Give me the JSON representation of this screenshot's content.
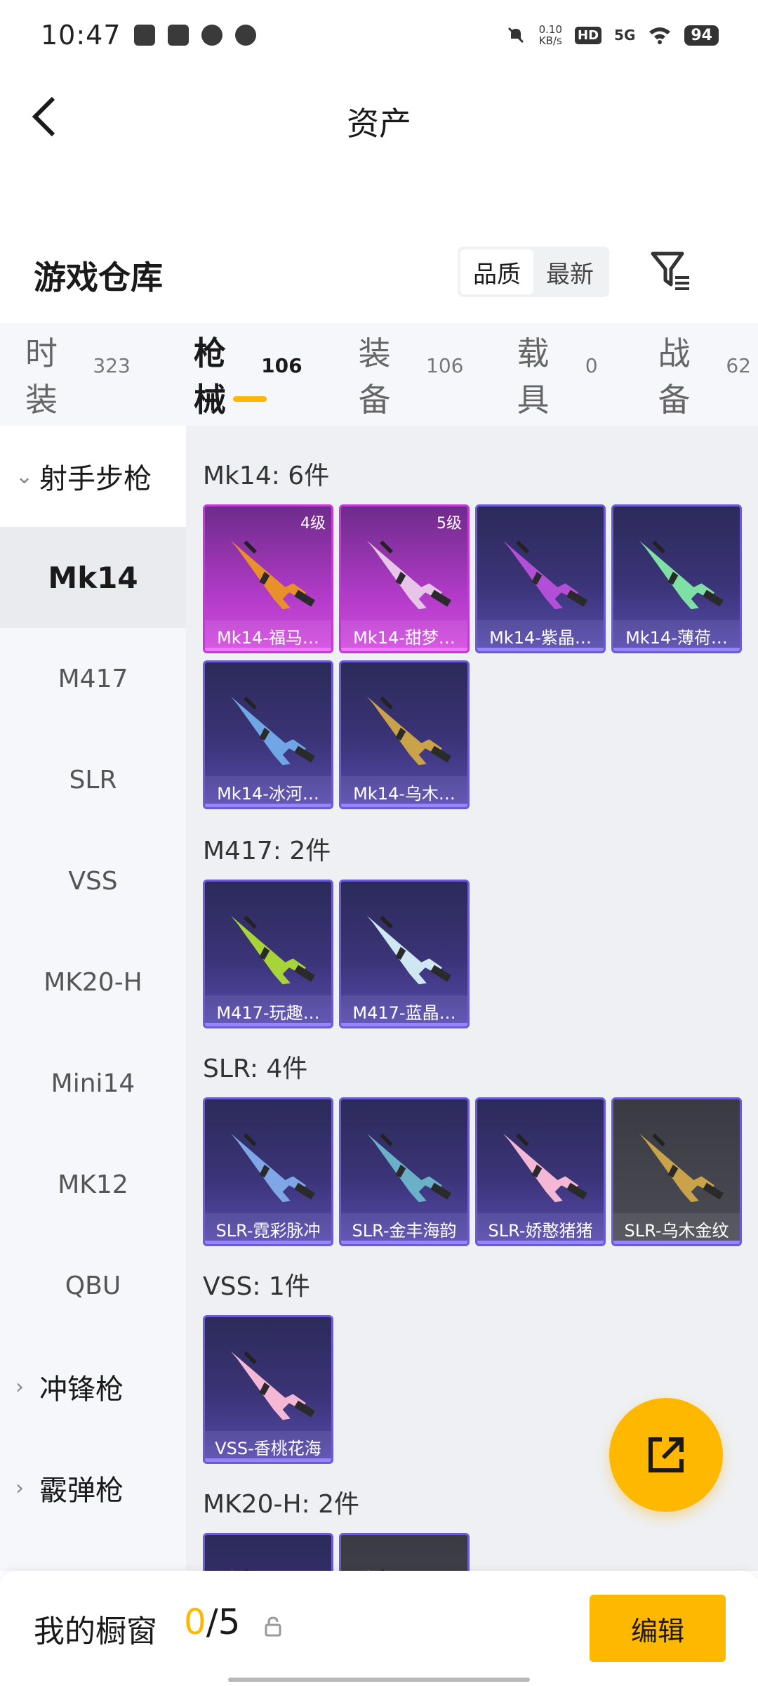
{
  "status_bar": {
    "time": "10:47",
    "net_speed": "0.10",
    "net_unit": "KB/s",
    "hd": "HD",
    "signal": "5G",
    "battery": "94"
  },
  "header": {
    "title": "资产"
  },
  "warehouse": {
    "title": "游戏仓库",
    "sort_options": [
      "品质",
      "最新"
    ]
  },
  "tabs": [
    {
      "label": "时装",
      "count": "323"
    },
    {
      "label": "枪械",
      "count": "106"
    },
    {
      "label": "装备",
      "count": "106"
    },
    {
      "label": "载具",
      "count": "0"
    },
    {
      "label": "战备",
      "count": "62"
    }
  ],
  "sidebar": {
    "group_open": "射手步枪",
    "items": [
      "Mk14",
      "M417",
      "SLR",
      "VSS",
      "MK20-H",
      "Mini14",
      "MK12",
      "QBU"
    ],
    "groups_collapsed": [
      "冲锋枪",
      "霰弹枪"
    ]
  },
  "sections": [
    {
      "title": "Mk14: 6件",
      "items": [
        {
          "name": "Mk14-福马…",
          "level": "4级",
          "style": "pink"
        },
        {
          "name": "Mk14-甜梦…",
          "level": "5级",
          "style": "pink"
        },
        {
          "name": "Mk14-紫晶…",
          "level": "",
          "style": "purple"
        },
        {
          "name": "Mk14-薄荷…",
          "level": "",
          "style": "purple"
        },
        {
          "name": "Mk14-冰河…",
          "level": "",
          "style": "purple"
        },
        {
          "name": "Mk14-乌木…",
          "level": "",
          "style": "purple"
        }
      ]
    },
    {
      "title": "M417: 2件",
      "items": [
        {
          "name": "M417-玩趣…",
          "level": "",
          "style": "purple"
        },
        {
          "name": "M417-蓝晶…",
          "level": "",
          "style": "purple"
        }
      ]
    },
    {
      "title": "SLR: 4件",
      "items": [
        {
          "name": "SLR-霓彩脉冲",
          "level": "",
          "style": "purple"
        },
        {
          "name": "SLR-金丰海韵",
          "level": "",
          "style": "purple"
        },
        {
          "name": "SLR-娇憨猪猪",
          "level": "",
          "style": "purple"
        },
        {
          "name": "SLR-乌木金纹",
          "level": "",
          "style": "gray"
        }
      ]
    },
    {
      "title": "VSS: 1件",
      "items": [
        {
          "name": "VSS-香桃花海",
          "level": "",
          "style": "purple"
        }
      ]
    },
    {
      "title": "MK20-H: 2件",
      "items": [
        {
          "name": "",
          "level": "",
          "style": "purple"
        },
        {
          "name": "",
          "level": "",
          "style": "gray"
        }
      ]
    }
  ],
  "showcase": {
    "label": "我的橱窗",
    "current": "0",
    "total": "/5",
    "edit_label": "编辑"
  },
  "colors": {
    "accent": "#ffb800",
    "card_purple": "#3b3478",
    "card_pink": "#b03ac7"
  }
}
